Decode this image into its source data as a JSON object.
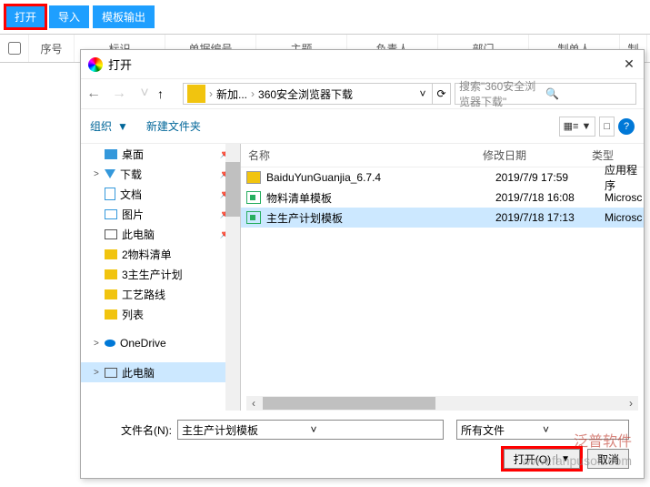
{
  "toolbar": {
    "open": "打开",
    "import": "导入",
    "export": "模板输出"
  },
  "grid": {
    "seq": "序号",
    "id": "标识",
    "bill": "单据编号",
    "subject": "主题",
    "owner": "负责人",
    "dept": "部门",
    "maker": "制单人",
    "make": "制"
  },
  "dialog": {
    "title": "打开",
    "crumb": {
      "p1": "新加...",
      "p2": "360安全浏览器下载"
    },
    "search_placeholder": "搜索\"360安全浏览器下载\"",
    "org": "组织",
    "org_dd": "▼",
    "newfolder": "新建文件夹",
    "view_label": "▦≡ ▼",
    "view_icon": "□",
    "cols": {
      "name": "名称",
      "date": "修改日期",
      "type": "类型"
    },
    "files": [
      {
        "name": "BaiduYunGuanjia_6.7.4",
        "date": "2019/7/9 17:59",
        "type": "应用程序",
        "icon": "exe"
      },
      {
        "name": "物料清单模板",
        "date": "2019/7/18 16:08",
        "type": "Microsc",
        "icon": "xls"
      },
      {
        "name": "主生产计划模板",
        "date": "2019/7/18 17:13",
        "type": "Microsc",
        "icon": "xls",
        "selected": true
      }
    ],
    "filename_label": "文件名(N):",
    "filename_value": "主生产计划模板",
    "filetype": "所有文件",
    "btn_open": "打开(O)",
    "btn_cancel": "取消"
  },
  "tree": [
    {
      "label": "桌面",
      "icon": "desk",
      "pin": true
    },
    {
      "label": "下载",
      "icon": "dl",
      "pin": true,
      "chev": ">"
    },
    {
      "label": "文档",
      "icon": "doc",
      "pin": true
    },
    {
      "label": "图片",
      "icon": "pic",
      "pin": true
    },
    {
      "label": "此电脑",
      "icon": "pc",
      "pin": true
    },
    {
      "label": "2物料清单",
      "icon": "folder"
    },
    {
      "label": "3主生产计划",
      "icon": "folder"
    },
    {
      "label": "工艺路线",
      "icon": "folder"
    },
    {
      "label": "列表",
      "icon": "folder"
    },
    {
      "label": "OneDrive",
      "icon": "od",
      "chev": ">",
      "gap": true
    },
    {
      "label": "此电脑",
      "icon": "pc",
      "chev": ">",
      "sel": true,
      "gap": true
    }
  ],
  "wm": {
    "brand": "泛普软件",
    "url": "www.fanpusoft.com"
  }
}
